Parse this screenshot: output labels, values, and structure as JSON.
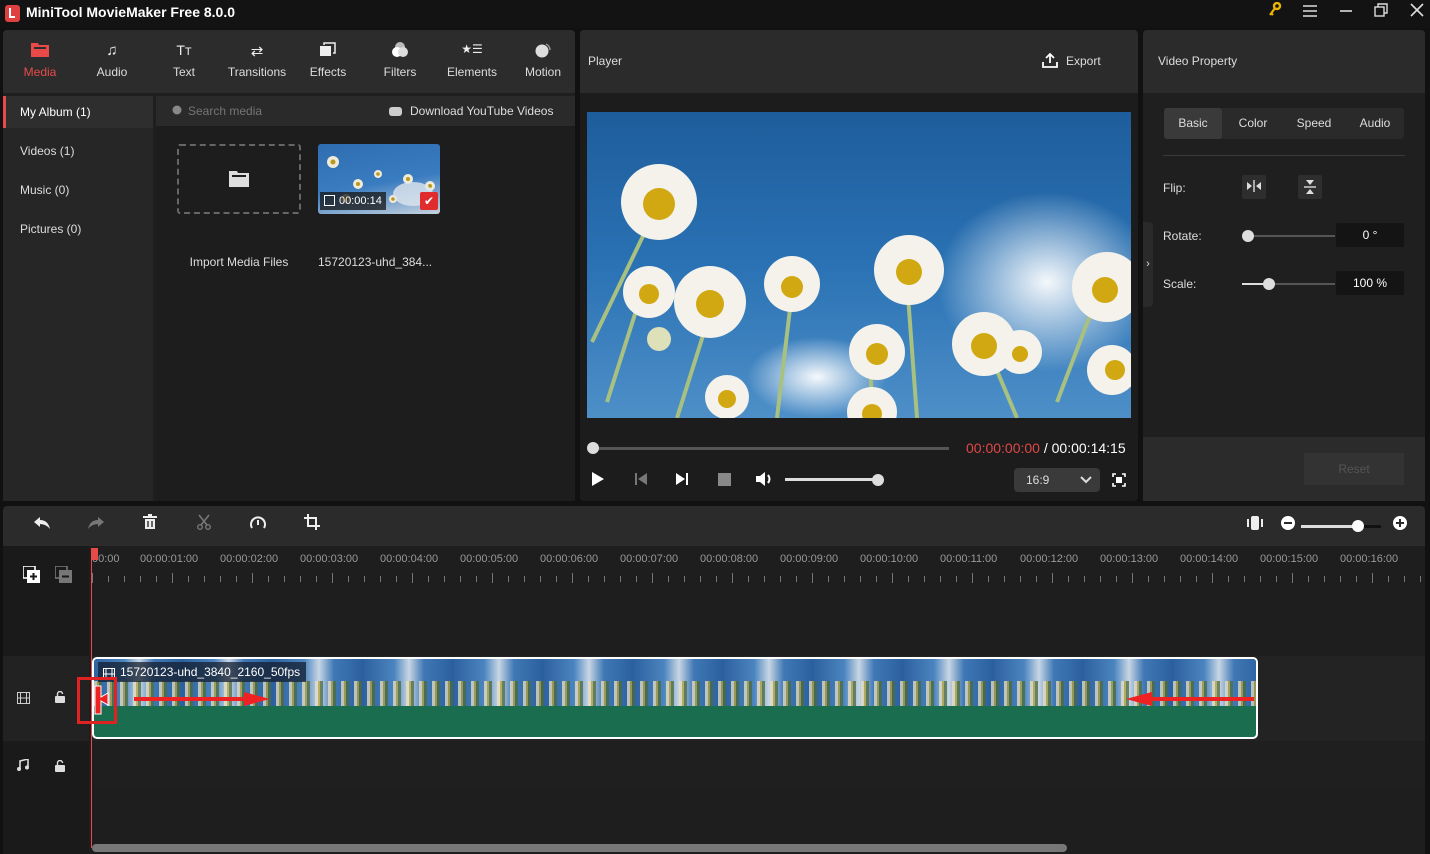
{
  "window": {
    "title": "MiniTool MovieMaker Free 8.0.0",
    "controls": [
      "key-icon",
      "menu-icon",
      "minimize-icon",
      "maximize-icon",
      "close-icon"
    ]
  },
  "media_tabs": [
    {
      "label": "Media",
      "icon": "folder-icon",
      "active": true
    },
    {
      "label": "Audio",
      "icon": "music-note-icon"
    },
    {
      "label": "Text",
      "icon": "text-icon"
    },
    {
      "label": "Transitions",
      "icon": "transition-arrows-icon"
    },
    {
      "label": "Effects",
      "icon": "effects-icon"
    },
    {
      "label": "Filters",
      "icon": "filters-icon"
    },
    {
      "label": "Elements",
      "icon": "elements-icon"
    },
    {
      "label": "Motion",
      "icon": "motion-icon"
    }
  ],
  "album": {
    "items": [
      {
        "label": "My Album (1)",
        "active": true
      },
      {
        "label": "Videos (1)"
      },
      {
        "label": "Music (0)"
      },
      {
        "label": "Pictures (0)"
      }
    ]
  },
  "media": {
    "search_placeholder": "Search media",
    "download_label": "Download YouTube Videos",
    "import_label": "Import Media Files",
    "clip_name": "15720123-uhd_384...",
    "clip_duration": "00:00:14"
  },
  "player": {
    "title": "Player",
    "export_label": "Export",
    "current_time": "00:00:00:00",
    "separator": " / ",
    "total_time": "00:00:14:15",
    "progress": 0,
    "volume": 1.0,
    "aspect_ratio": "16:9"
  },
  "property": {
    "title": "Video Property",
    "tabs": [
      "Basic",
      "Color",
      "Speed",
      "Audio"
    ],
    "active_tab": "Basic",
    "flip_label": "Flip:",
    "rotate_label": "Rotate:",
    "rotate_value": "0 °",
    "rotate_fraction": 0,
    "scale_label": "Scale:",
    "scale_value": "100 %",
    "scale_fraction": 0.28,
    "reset_label": "Reset"
  },
  "timeline": {
    "zoom_fraction": 0.8,
    "ruler_labels": [
      "00:00",
      "00:00:01:00",
      "00:00:02:00",
      "00:00:03:00",
      "00:00:04:00",
      "00:00:05:00",
      "00:00:06:00",
      "00:00:07:00",
      "00:00:08:00",
      "00:00:09:00",
      "00:00:10:00",
      "00:00:11:00",
      "00:00:12:00",
      "00:00:13:00",
      "00:00:14:00",
      "00:00:15:00",
      "00:00:16:00"
    ],
    "clip_name": "15720123-uhd_3840_2160_50fps"
  },
  "colors": {
    "accent": "#e84a4a",
    "clip_audio": "#1a6e4f",
    "annotation": "#e02222"
  }
}
